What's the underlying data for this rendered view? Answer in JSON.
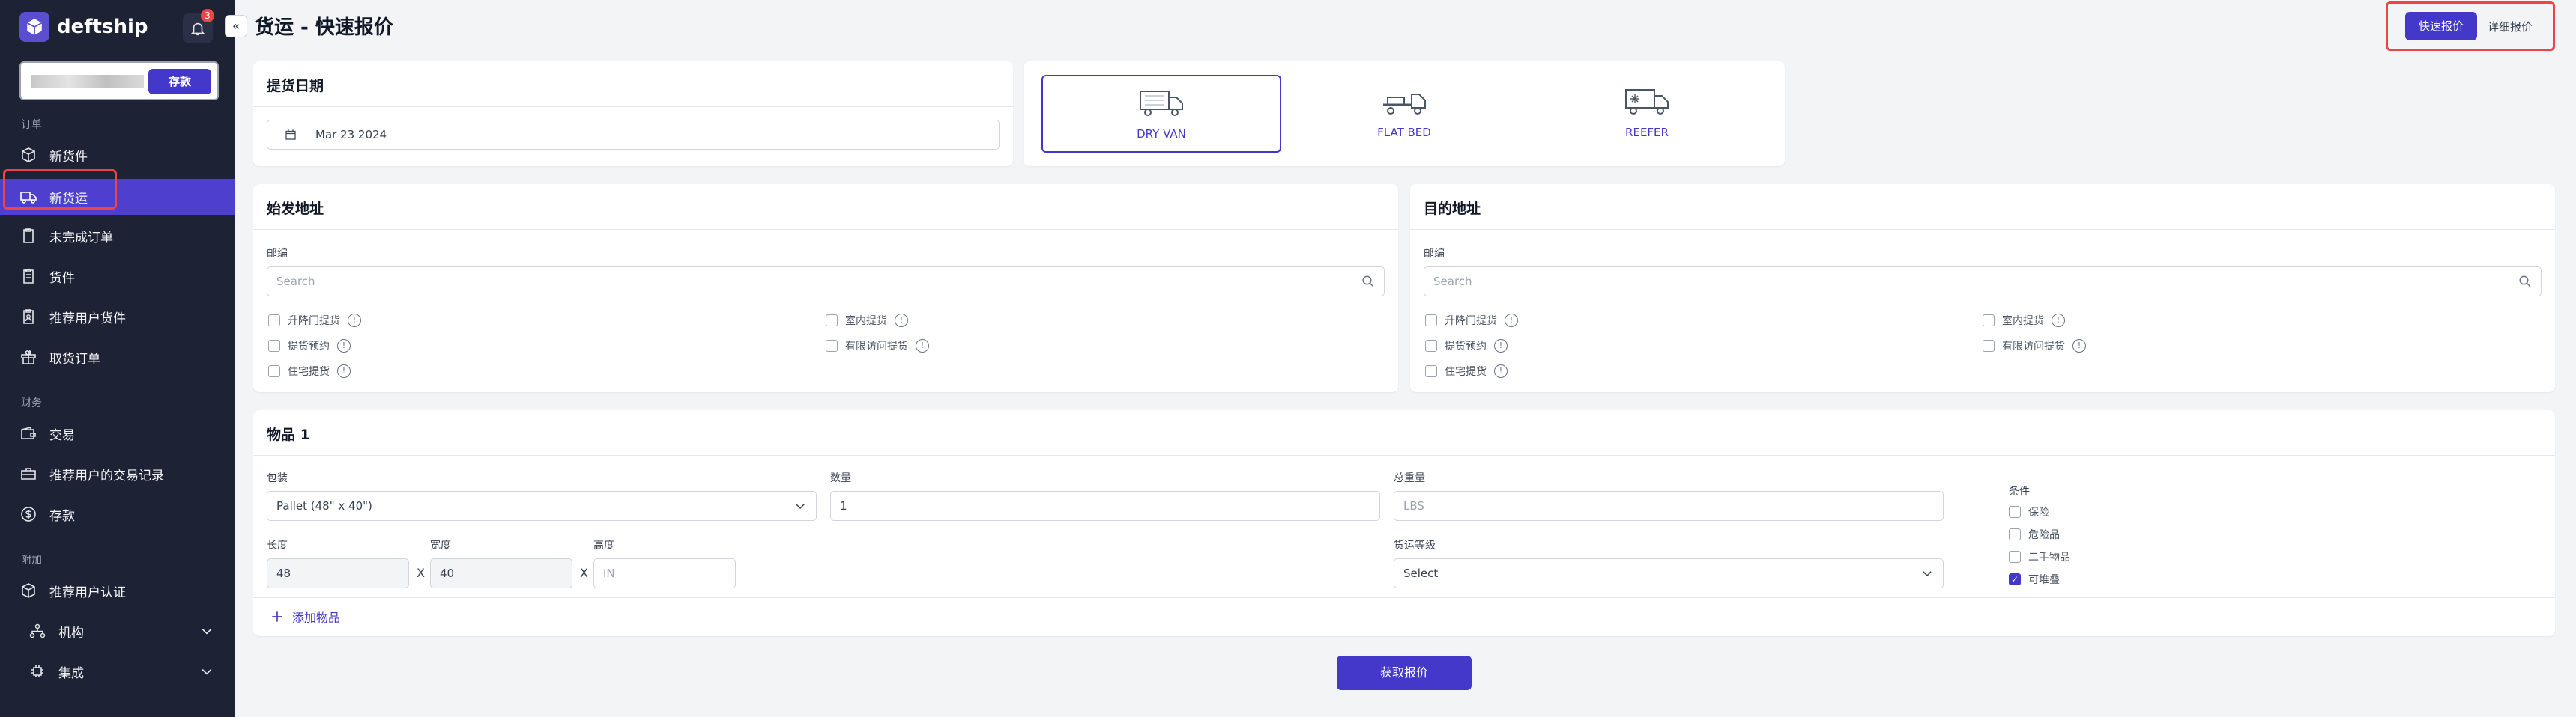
{
  "sidebar": {
    "brand": "deftship",
    "notification_count": "3",
    "collapse_glyph": "«",
    "deposit_label": "存款",
    "section_orders": "订单",
    "section_finance": "财务",
    "section_extra": "附加",
    "items": [
      {
        "label": "新货件",
        "icon": "box-icon"
      },
      {
        "label": "新货运",
        "icon": "truck-icon",
        "active": true
      },
      {
        "label": "未完成订单",
        "icon": "clipboard-icon"
      },
      {
        "label": "货件",
        "icon": "clipboard-list-icon"
      },
      {
        "label": "推荐用户货件",
        "icon": "clipboard-user-icon"
      },
      {
        "label": "取货订单",
        "icon": "gift-icon"
      },
      {
        "label": "交易",
        "icon": "wallet-icon"
      },
      {
        "label": "推荐用户的交易记录",
        "icon": "briefcase-icon"
      },
      {
        "label": "存款",
        "icon": "dollar-icon"
      },
      {
        "label": "推荐用户认证",
        "icon": "verified-box-icon"
      },
      {
        "label": "机构",
        "icon": "org-icon"
      },
      {
        "label": "集成",
        "icon": "integration-icon"
      }
    ]
  },
  "header": {
    "title": "货运 - 快速报价",
    "quick_quote": "快速报价",
    "detailed_quote": "详细报价"
  },
  "pickup": {
    "title": "提货日期",
    "date": "Mar 23 2024"
  },
  "trucks": [
    {
      "label": "DRY VAN",
      "selected": true
    },
    {
      "label": "FLAT BED",
      "selected": false
    },
    {
      "label": "REEFER",
      "selected": false
    }
  ],
  "origin": {
    "title": "始发地址",
    "zip_label": "邮编",
    "zip_placeholder": "Search",
    "options": [
      "升降门提货",
      "室内提货",
      "提货预约",
      "有限访问提货",
      "住宅提货"
    ]
  },
  "destination": {
    "title": "目的地址",
    "zip_label": "邮编",
    "zip_placeholder": "Search",
    "options": [
      "升降门提货",
      "室内提货",
      "提货预约",
      "有限访问提货",
      "住宅提货"
    ]
  },
  "item": {
    "title": "物品 1",
    "packaging_label": "包装",
    "packaging_value": "Pallet (48\" x 40\")",
    "quantity_label": "数量",
    "quantity_value": "1",
    "weight_label": "总重量",
    "weight_placeholder": "LBS",
    "length_label": "长度",
    "length_value": "48",
    "width_label": "宽度",
    "width_value": "40",
    "height_label": "高度",
    "height_placeholder": "IN",
    "x_sep": "X",
    "class_label": "货运等级",
    "class_value": "Select",
    "conditions_label": "条件",
    "conditions": [
      {
        "label": "保险",
        "checked": false
      },
      {
        "label": "危险品",
        "checked": false
      },
      {
        "label": "二手物品",
        "checked": false
      },
      {
        "label": "可堆叠",
        "checked": true
      }
    ],
    "add_item": "添加物品"
  },
  "submit_label": "获取报价",
  "colors": {
    "sidebar": "#1e2235",
    "accent": "#4338ca",
    "highlight": "#ef4444"
  }
}
